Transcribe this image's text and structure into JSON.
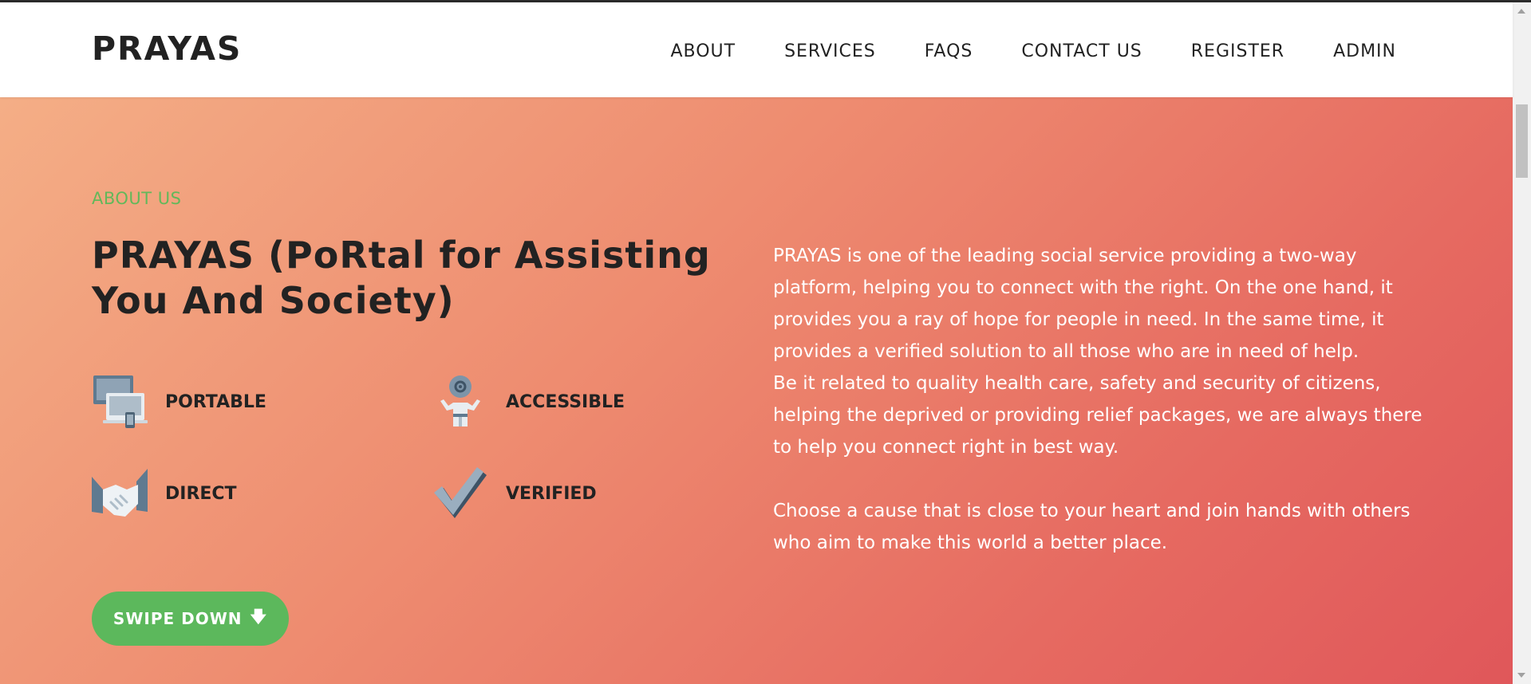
{
  "nav": {
    "brand": "PRAYAS",
    "links": [
      "ABOUT",
      "SERVICES",
      "FAQS",
      "CONTACT US",
      "REGISTER",
      "ADMIN"
    ]
  },
  "hero": {
    "eyebrow": "ABOUT US",
    "title": "PRAYAS (PoRtal for Assisting You And Society)",
    "features": [
      {
        "label": "PORTABLE",
        "icon": "devices-icon"
      },
      {
        "label": "ACCESSIBLE",
        "icon": "support-gear-icon"
      },
      {
        "label": "DIRECT",
        "icon": "handshake-icon"
      },
      {
        "label": "VERIFIED",
        "icon": "checkmark-icon"
      }
    ],
    "button_label": "SWIPE DOWN",
    "button_icon": "arrow-down-icon",
    "paragraphs": [
      "PRAYAS is one of the leading social service providing a two-way platform, helping you to connect with the right. On the one hand, it provides you a ray of hope for people in need. In the same time, it provides a verified solution to all those who are in need of help.",
      "Be it related to quality health care, safety and security of citizens, helping the deprived or providing relief packages, we are always there to help you connect right in best way.",
      "Choose a cause that is close to your heart and join hands with others who aim to make this world a better place."
    ]
  },
  "colors": {
    "accent_green": "#5cb85c",
    "eyebrow_green": "#62b85a",
    "gradient_start": "#f4ae86",
    "gradient_end": "#e0575a",
    "heading": "#222222"
  }
}
